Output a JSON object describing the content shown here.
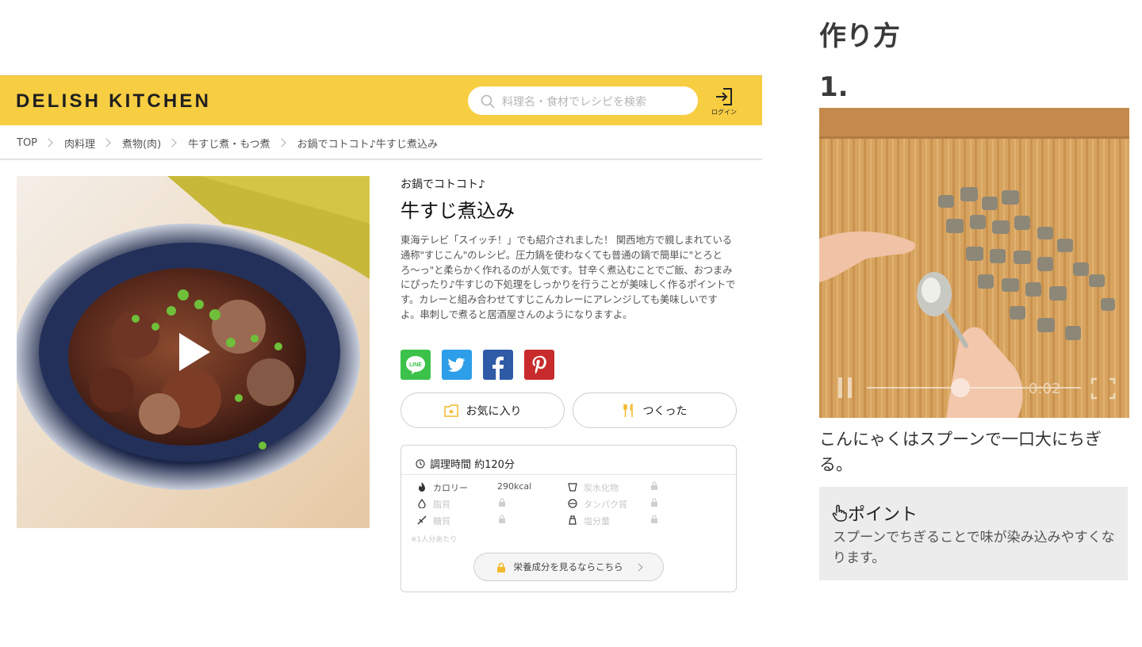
{
  "header": {
    "logo": "DELISH KITCHEN",
    "search_placeholder": "料理名・食材でレシピを検索",
    "login_label": "ログイン",
    "brand_color": "#f7cd42"
  },
  "breadcrumb": [
    "TOP",
    "肉料理",
    "煮物(肉)",
    "牛すじ煮・もつ煮",
    "お鍋でコトコト♪牛すじ煮込み"
  ],
  "recipe": {
    "subtitle": "お鍋でコトコト♪",
    "title": "牛すじ煮込み",
    "description": "東海テレビ「スイッチ！」でも紹介されました！ 関西地方で親しまれている通称\"すじこん\"のレシピ。圧力鍋を使わなくても普通の鍋で簡単に\"とろとろ〜っ\"と柔らかく作れるのが人気です。甘辛く煮込むことでご飯、おつまみにぴったり♪牛すじの下処理をしっかりを行うことが美味しく作るポイントです。カレーと組み合わせてすじこんカレーにアレンジしても美味しいですよ。串刺しで煮ると居酒屋さんのようになりますよ。",
    "share": [
      "LINE",
      "Twitter",
      "Facebook",
      "Pinterest"
    ],
    "favorite_label": "お気に入り",
    "made_label": "つくった"
  },
  "nutrition": {
    "cook_time": "調理時間 約120分",
    "calorie_label": "カロリー",
    "calorie_value": "290kcal",
    "carb_label": "炭水化物",
    "fat_label": "脂質",
    "protein_label": "タンパク質",
    "sugar_label": "糖質",
    "salt_label": "塩分量",
    "per_serving": "※1人分あたり",
    "unlock_button": "栄養成分を見るならこちら"
  },
  "steps": {
    "heading": "作り方",
    "number": "1.",
    "video_time": "0:02",
    "text": "こんにゃくはスプーンで一口大にちぎる。",
    "point_title": "ポイント",
    "point_text": "スプーンでちぎることで味が染み込みやすくなります。"
  }
}
